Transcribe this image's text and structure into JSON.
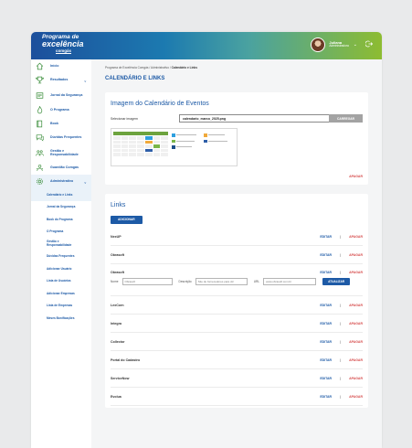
{
  "header": {
    "logo": {
      "line1": "Programa de",
      "line2": "excelência",
      "line3": "comgás"
    },
    "user": {
      "name": "Juliana",
      "role": "Administradora"
    }
  },
  "sidebar": {
    "items": [
      {
        "label": "Início",
        "icon": "home-icon"
      },
      {
        "label": "Resultados",
        "icon": "trophy-icon",
        "chevron": true
      },
      {
        "label": "Jornal da Segurança",
        "icon": "newspaper-icon",
        "tall": true
      },
      {
        "label": "O Programa",
        "icon": "flame-icon"
      },
      {
        "label": "Book",
        "icon": "book-icon"
      },
      {
        "label": "Dúvidas Frequentes",
        "icon": "chat-icon"
      },
      {
        "label": "Gestão e Responsabilidade",
        "icon": "people-icon",
        "tall": true
      },
      {
        "label": "Guardião Comgás",
        "icon": "guardian-icon"
      },
      {
        "label": "Administrativo",
        "icon": "gear-icon",
        "chevron": true,
        "active": true
      }
    ],
    "subitems": [
      {
        "label": "Calendário e Links",
        "active": true
      },
      {
        "label": "Jornal da Segurança"
      },
      {
        "label": "Book do Programa"
      },
      {
        "label": "O Programa"
      },
      {
        "label": "Gestão e Responsabilidade"
      },
      {
        "label": "Dúvidas Frequentes"
      },
      {
        "label": "Adicionar Usuário"
      },
      {
        "label": "Lista de Usuários"
      },
      {
        "label": "Adicionar Empresas"
      },
      {
        "label": "Lista de Empresas"
      },
      {
        "label": "Meses Bonificações"
      }
    ]
  },
  "breadcrumb": {
    "path": "Programa de Excelência Comgás / Administrativo / ",
    "current": "Calendário e Links"
  },
  "page_title": "CALENDÁRIO E LINKS",
  "calendar_section": {
    "title": "Imagem do Calendário de Eventos",
    "file_label": "Selecionar imagem",
    "file_value": "calendario_marco_2025.png",
    "upload_button": "CARREGAR",
    "delete_label": "APAGAR"
  },
  "links_section": {
    "title": "Links",
    "add_button": "ADICIONAR",
    "edit_label": "EDITAR",
    "delete_label": "APAGAR",
    "separator": "|",
    "items": [
      {
        "name": "NexUP"
      },
      {
        "name": "Obrasoft"
      },
      {
        "name": "Obrasoft",
        "expanded": true
      },
      {
        "name": "LexCorn"
      },
      {
        "name": "Integra"
      },
      {
        "name": "Collector"
      },
      {
        "name": "Portal do Cadastro"
      },
      {
        "name": "ServiceNow"
      },
      {
        "name": "Evolua"
      }
    ],
    "edit_form": {
      "name_label": "Nome",
      "name_value": "Obrasoft",
      "desc_label": "Descrição",
      "desc_value": "Site de fornecedores para dd",
      "url_label": "URL",
      "url_value": "www.obrasoft.com.br",
      "update_button": "ATUALIZAR"
    }
  },
  "colors": {
    "primary": "#1d5aa6",
    "danger": "#d64a4a",
    "header_gradient": [
      "#1c4f9c",
      "#4aa2a0",
      "#8dbc31"
    ]
  }
}
